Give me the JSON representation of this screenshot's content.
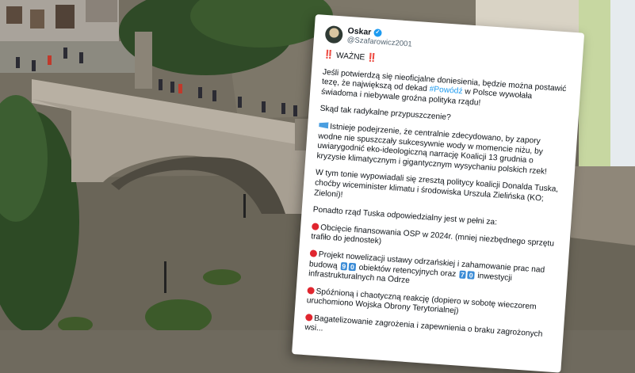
{
  "tweet": {
    "name": "Oskar",
    "handle": "@Szafarowicz2001",
    "header_marks": "‼️",
    "header_title": "WAŻNE",
    "p1_before": "Jeśli potwierdzą się nieoficjalne doniesienia, będzie można postawić tezę, że największą od dekad ",
    "p1_hashtag": "#Powódź",
    "p1_after": " w Polsce wywołała świadoma i niebywale groźna polityka rządu!",
    "p2": "Skąd tak radykalne przypuszczenie?",
    "p3": "Istnieje podejrzenie, że centralnie zdecydowano, by zapory wodne nie spuszczały sukcesywnie wody w momencie niżu, by uwiarygodnić eko-ideologiczną narrację Koalicji 13 grudnia o kryzysie klimatycznym i gigantycznym wysychaniu polskich rzek!",
    "p4": "W tym tonie wypowiadali się zresztą politycy koalicji Donalda Tuska, choćby wiceminister klimatu i środowiska Urszula Zielińska (KO; Zieloni)!",
    "p5": "Ponadto rząd Tuska odpowiedzialny jest w pełni za:",
    "item1": "Obcięcie finansowania OSP w 2024r. (mniej niezbędnego sprzętu trafiło do jednostek)",
    "item2_a": "Projekt nowelizacji ustawy odrzańskiej i zahamowanie prac nad budową",
    "item2_key1a": "9",
    "item2_key1b": "0",
    "item2_b": "obiektów retencyjnych oraz",
    "item2_key2a": "7",
    "item2_key2b": "0",
    "item2_c": "inwestycji infrastrukturalnych na Odrze",
    "item3": "Spóźnioną i chaotyczną reakcję (dopiero w sobotę wieczorem uruchomiono Wojska Obrony Terytorialnej)",
    "item4": "Bagatelizowanie zagrożenia i zapewnienia o braku zagrożonych wsi..."
  },
  "colors": {
    "accent_blue": "#1d9bf0",
    "warning_red": "#e0262f",
    "water": "#6f6a5e"
  }
}
